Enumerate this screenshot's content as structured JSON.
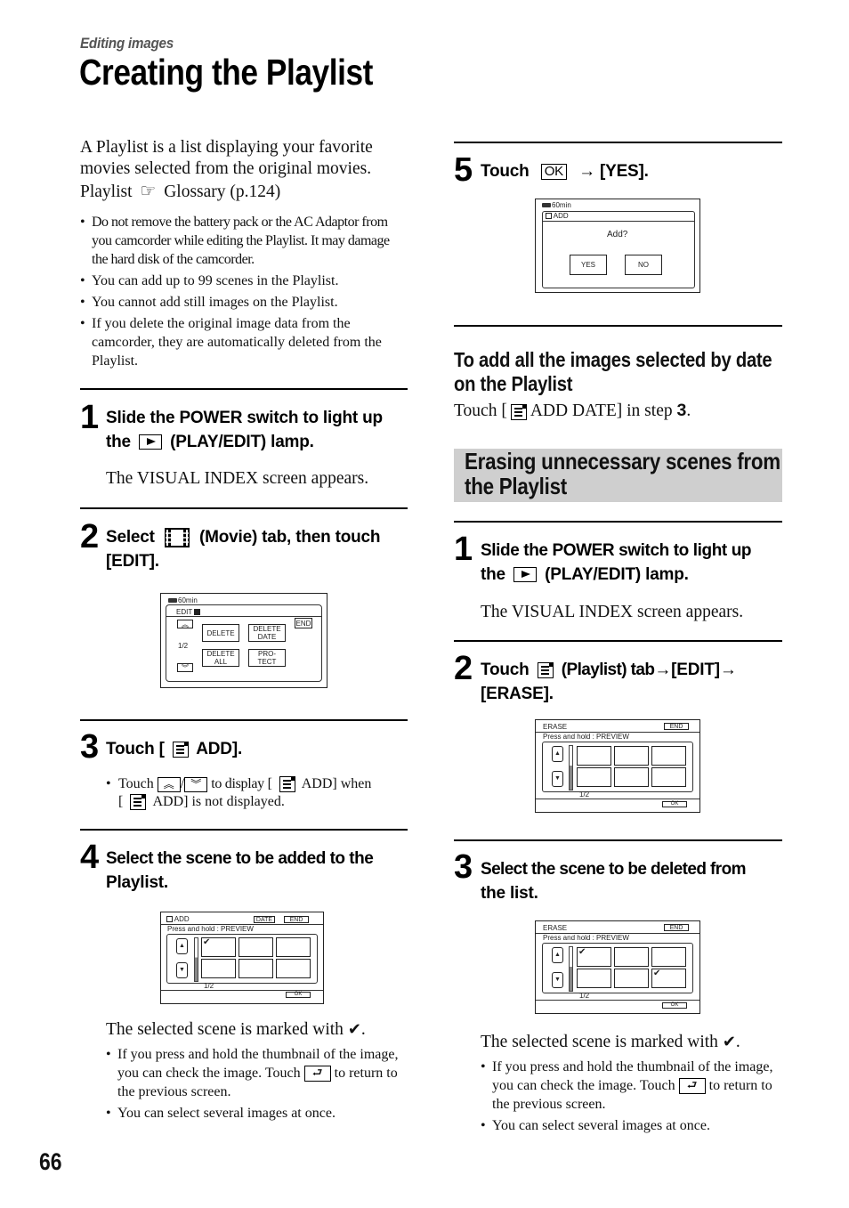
{
  "header": {
    "section_label": "Editing images",
    "title": "Creating the Playlist"
  },
  "intro": {
    "paragraph_a": "A Playlist is a list displaying your favorite movies selected from the original movies.",
    "paragraph_b_pre": "Playlist",
    "paragraph_b_post": "Glossary (p.124)",
    "bullets": [
      "Do not remove the battery pack or the AC Adaptor from you camcorder while editing the Playlist. It may damage the hard disk of the camcorder.",
      "You can add up to 99 scenes in the Playlist.",
      "You cannot add still images on the Playlist.",
      "If you delete the original image data from the camcorder, they are automatically deleted from the Playlist."
    ]
  },
  "create_steps": {
    "step1": {
      "num": "1",
      "line1": "Slide the POWER switch to light up",
      "line2_pre": "the",
      "line2_post": "(PLAY/EDIT) lamp.",
      "result": "The VISUAL INDEX screen appears."
    },
    "step2": {
      "num": "2",
      "pre": "Select",
      "post": "(Movie) tab, then touch",
      "line2": "[EDIT].",
      "screen": {
        "battery": "60min",
        "title": "EDIT",
        "page": "1/2",
        "end": "END",
        "buttons": [
          "DELETE",
          "DELETE DATE",
          "DELETE ALL",
          "PRO- TECT"
        ]
      }
    },
    "step3": {
      "num": "3",
      "pre": "Touch [",
      "post": "ADD].",
      "bullet_pre": "Touch",
      "bullet_slash": "/",
      "bullet_mid": "to display [",
      "bullet_mid2": "ADD] when",
      "bullet_line2_pre": "[",
      "bullet_line2_post": "ADD] is not displayed."
    },
    "step4": {
      "num": "4",
      "line1": "Select the scene to be added to the",
      "line2": "Playlist.",
      "screen": {
        "title": "ADD",
        "date": "DATE",
        "end": "END",
        "hint": "Press and hold : PREVIEW",
        "page": "1/2",
        "ok": "OK",
        "checked": [
          true,
          false,
          false,
          false,
          false,
          false
        ]
      },
      "result_pre": "The selected scene is marked with",
      "result_post": ".",
      "bullets": [
        "If you press and hold the thumbnail of the image, you can check the image. Touch",
        "to return to the previous screen.",
        "You can select several images at once."
      ]
    },
    "step5": {
      "num": "5",
      "pre": "Touch",
      "ok": "OK",
      "post": "[YES].",
      "screen": {
        "battery": "60min",
        "title": "ADD",
        "question": "Add?",
        "yes": "YES",
        "no": "NO"
      }
    }
  },
  "add_by_date": {
    "heading": "To add all the images selected by date on the Playlist",
    "text_pre": "Touch [",
    "text_mid": "ADD DATE] in step",
    "text_step": "3",
    "text_end": "."
  },
  "erase_section": {
    "heading": "Erasing unnecessary scenes from the Playlist",
    "step1": {
      "num": "1",
      "line1": "Slide the POWER switch to light up",
      "line2_pre": "the",
      "line2_post": "(PLAY/EDIT) lamp.",
      "result": "The VISUAL INDEX screen appears."
    },
    "step2": {
      "num": "2",
      "pre": "Touch",
      "mid": "(Playlist) tab",
      "edit": "[EDIT]",
      "line2": "[ERASE].",
      "screen": {
        "title": "ERASE",
        "end": "END",
        "hint": "Press and hold : PREVIEW",
        "page": "1/2",
        "ok": "OK",
        "checked": [
          false,
          false,
          false,
          false,
          false,
          false
        ]
      }
    },
    "step3": {
      "num": "3",
      "line1": "Select the scene to be deleted from",
      "line2": "the list.",
      "screen": {
        "title": "ERASE",
        "end": "END",
        "hint": "Press and hold : PREVIEW",
        "page": "1/2",
        "ok": "OK",
        "checked": [
          true,
          false,
          false,
          false,
          false,
          true
        ]
      },
      "result_pre": "The selected scene is marked with",
      "result_post": ".",
      "bullets": [
        "If you press and hold the thumbnail of the image, you can check the image. Touch",
        "to return to the previous screen.",
        "You can select several images at once."
      ]
    }
  },
  "icons": {
    "arrow": "→",
    "check": "✔",
    "up": "︽",
    "down": "︾",
    "return": "⮐",
    "pointer": "☞"
  },
  "footer": {
    "page_number": "66"
  }
}
